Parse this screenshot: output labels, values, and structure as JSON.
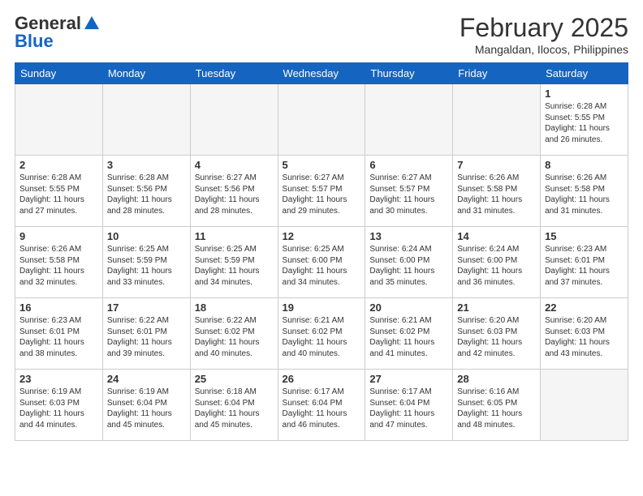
{
  "header": {
    "logo_general": "General",
    "logo_blue": "Blue",
    "month_title": "February 2025",
    "location": "Mangaldan, Ilocos, Philippines"
  },
  "weekdays": [
    "Sunday",
    "Monday",
    "Tuesday",
    "Wednesday",
    "Thursday",
    "Friday",
    "Saturday"
  ],
  "weeks": [
    [
      {
        "day": "",
        "empty": true
      },
      {
        "day": "",
        "empty": true
      },
      {
        "day": "",
        "empty": true
      },
      {
        "day": "",
        "empty": true
      },
      {
        "day": "",
        "empty": true
      },
      {
        "day": "",
        "empty": true
      },
      {
        "day": "1",
        "sunrise": "6:28 AM",
        "sunset": "5:55 PM",
        "daylight": "11 hours and 26 minutes."
      }
    ],
    [
      {
        "day": "2",
        "sunrise": "6:28 AM",
        "sunset": "5:55 PM",
        "daylight": "11 hours and 27 minutes."
      },
      {
        "day": "3",
        "sunrise": "6:28 AM",
        "sunset": "5:56 PM",
        "daylight": "11 hours and 28 minutes."
      },
      {
        "day": "4",
        "sunrise": "6:27 AM",
        "sunset": "5:56 PM",
        "daylight": "11 hours and 28 minutes."
      },
      {
        "day": "5",
        "sunrise": "6:27 AM",
        "sunset": "5:57 PM",
        "daylight": "11 hours and 29 minutes."
      },
      {
        "day": "6",
        "sunrise": "6:27 AM",
        "sunset": "5:57 PM",
        "daylight": "11 hours and 30 minutes."
      },
      {
        "day": "7",
        "sunrise": "6:26 AM",
        "sunset": "5:58 PM",
        "daylight": "11 hours and 31 minutes."
      },
      {
        "day": "8",
        "sunrise": "6:26 AM",
        "sunset": "5:58 PM",
        "daylight": "11 hours and 31 minutes."
      }
    ],
    [
      {
        "day": "9",
        "sunrise": "6:26 AM",
        "sunset": "5:58 PM",
        "daylight": "11 hours and 32 minutes."
      },
      {
        "day": "10",
        "sunrise": "6:25 AM",
        "sunset": "5:59 PM",
        "daylight": "11 hours and 33 minutes."
      },
      {
        "day": "11",
        "sunrise": "6:25 AM",
        "sunset": "5:59 PM",
        "daylight": "11 hours and 34 minutes."
      },
      {
        "day": "12",
        "sunrise": "6:25 AM",
        "sunset": "6:00 PM",
        "daylight": "11 hours and 34 minutes."
      },
      {
        "day": "13",
        "sunrise": "6:24 AM",
        "sunset": "6:00 PM",
        "daylight": "11 hours and 35 minutes."
      },
      {
        "day": "14",
        "sunrise": "6:24 AM",
        "sunset": "6:00 PM",
        "daylight": "11 hours and 36 minutes."
      },
      {
        "day": "15",
        "sunrise": "6:23 AM",
        "sunset": "6:01 PM",
        "daylight": "11 hours and 37 minutes."
      }
    ],
    [
      {
        "day": "16",
        "sunrise": "6:23 AM",
        "sunset": "6:01 PM",
        "daylight": "11 hours and 38 minutes."
      },
      {
        "day": "17",
        "sunrise": "6:22 AM",
        "sunset": "6:01 PM",
        "daylight": "11 hours and 39 minutes."
      },
      {
        "day": "18",
        "sunrise": "6:22 AM",
        "sunset": "6:02 PM",
        "daylight": "11 hours and 40 minutes."
      },
      {
        "day": "19",
        "sunrise": "6:21 AM",
        "sunset": "6:02 PM",
        "daylight": "11 hours and 40 minutes."
      },
      {
        "day": "20",
        "sunrise": "6:21 AM",
        "sunset": "6:02 PM",
        "daylight": "11 hours and 41 minutes."
      },
      {
        "day": "21",
        "sunrise": "6:20 AM",
        "sunset": "6:03 PM",
        "daylight": "11 hours and 42 minutes."
      },
      {
        "day": "22",
        "sunrise": "6:20 AM",
        "sunset": "6:03 PM",
        "daylight": "11 hours and 43 minutes."
      }
    ],
    [
      {
        "day": "23",
        "sunrise": "6:19 AM",
        "sunset": "6:03 PM",
        "daylight": "11 hours and 44 minutes."
      },
      {
        "day": "24",
        "sunrise": "6:19 AM",
        "sunset": "6:04 PM",
        "daylight": "11 hours and 45 minutes."
      },
      {
        "day": "25",
        "sunrise": "6:18 AM",
        "sunset": "6:04 PM",
        "daylight": "11 hours and 45 minutes."
      },
      {
        "day": "26",
        "sunrise": "6:17 AM",
        "sunset": "6:04 PM",
        "daylight": "11 hours and 46 minutes."
      },
      {
        "day": "27",
        "sunrise": "6:17 AM",
        "sunset": "6:04 PM",
        "daylight": "11 hours and 47 minutes."
      },
      {
        "day": "28",
        "sunrise": "6:16 AM",
        "sunset": "6:05 PM",
        "daylight": "11 hours and 48 minutes."
      },
      {
        "day": "",
        "empty": true
      }
    ]
  ]
}
